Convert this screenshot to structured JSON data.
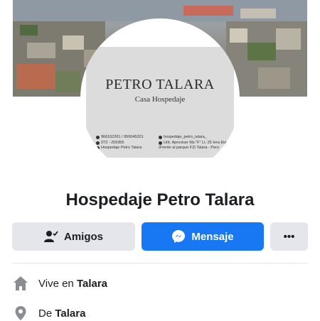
{
  "card": {
    "title": "PETRO TALARA",
    "subtitle": "Casa Hospedaje",
    "phone1": "966162261 / 950645201",
    "phone2": "073 - 259355",
    "facebook": "Hospedaje Petro Talara",
    "instagram": "hospedaje_petro_talara_",
    "address1": "Urb. Aproviser Mz.\"F\" Lt. 25 Iera Etapa",
    "address2": "(Frente al parque F2) Talara - Peru"
  },
  "page": {
    "name": "Hospedaje Petro Talara"
  },
  "actions": {
    "friends_label": "Amigos",
    "message_label": "Mensaje",
    "more_label": "•••"
  },
  "about": {
    "lives_prefix": "Vive en ",
    "lives_city": "Talara",
    "from_prefix": "De ",
    "from_city": "Talara"
  },
  "icons": {
    "friends": "person-check-icon",
    "messenger": "messenger-icon",
    "home": "home-icon",
    "location": "location-pin-icon"
  },
  "colors": {
    "primary_button": "#1877f2",
    "secondary_button": "#e4e6eb",
    "text": "#1c1e21"
  }
}
